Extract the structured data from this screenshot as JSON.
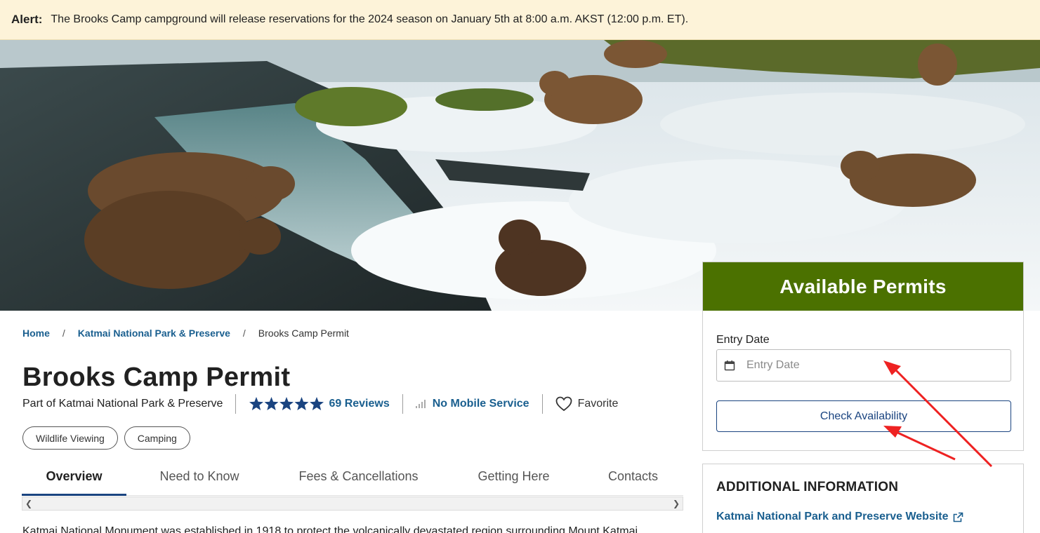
{
  "alert": {
    "label": "Alert:",
    "message": "The Brooks Camp campground will release reservations for the 2024 season on January 5th at 8:00 a.m. AKST (12:00 p.m. ET)."
  },
  "breadcrumb": {
    "home": "Home",
    "parent": "Katmai National Park & Preserve",
    "current": "Brooks Camp Permit",
    "separator": "/"
  },
  "page": {
    "title": "Brooks Camp Permit",
    "part_of": "Part of Katmai National Park & Preserve",
    "rating": 5,
    "reviews": "69 Reviews",
    "mobile_service": "No Mobile Service",
    "favorite": "Favorite"
  },
  "tags": [
    "Wildlife Viewing",
    "Camping"
  ],
  "tabs": [
    {
      "label": "Overview",
      "active": true
    },
    {
      "label": "Need to Know",
      "active": false
    },
    {
      "label": "Fees & Cancellations",
      "active": false
    },
    {
      "label": "Getting Here",
      "active": false
    },
    {
      "label": "Contacts",
      "active": false
    }
  ],
  "overview_partial": "Katmai National Monument was established in 1918 to protect the volcanically devastated region surrounding Mount Katmai",
  "permits": {
    "heading": "Available Permits",
    "entry_label": "Entry Date",
    "entry_placeholder": "Entry Date",
    "check_button": "Check Availability"
  },
  "additional": {
    "heading": "ADDITIONAL INFORMATION",
    "link": "Katmai National Park and Preserve Website"
  },
  "icons": {
    "calendar": "calendar-icon",
    "star": "star-icon",
    "signal": "signal-icon",
    "heart": "heart-icon",
    "external": "external-link-icon"
  },
  "colors": {
    "alert_bg": "#fdf3d9",
    "permits_header": "#4b7100",
    "link": "#1a5f8f",
    "primary": "#1a4480",
    "star": "#1a4480",
    "annotation_arrow": "#ee2222"
  }
}
